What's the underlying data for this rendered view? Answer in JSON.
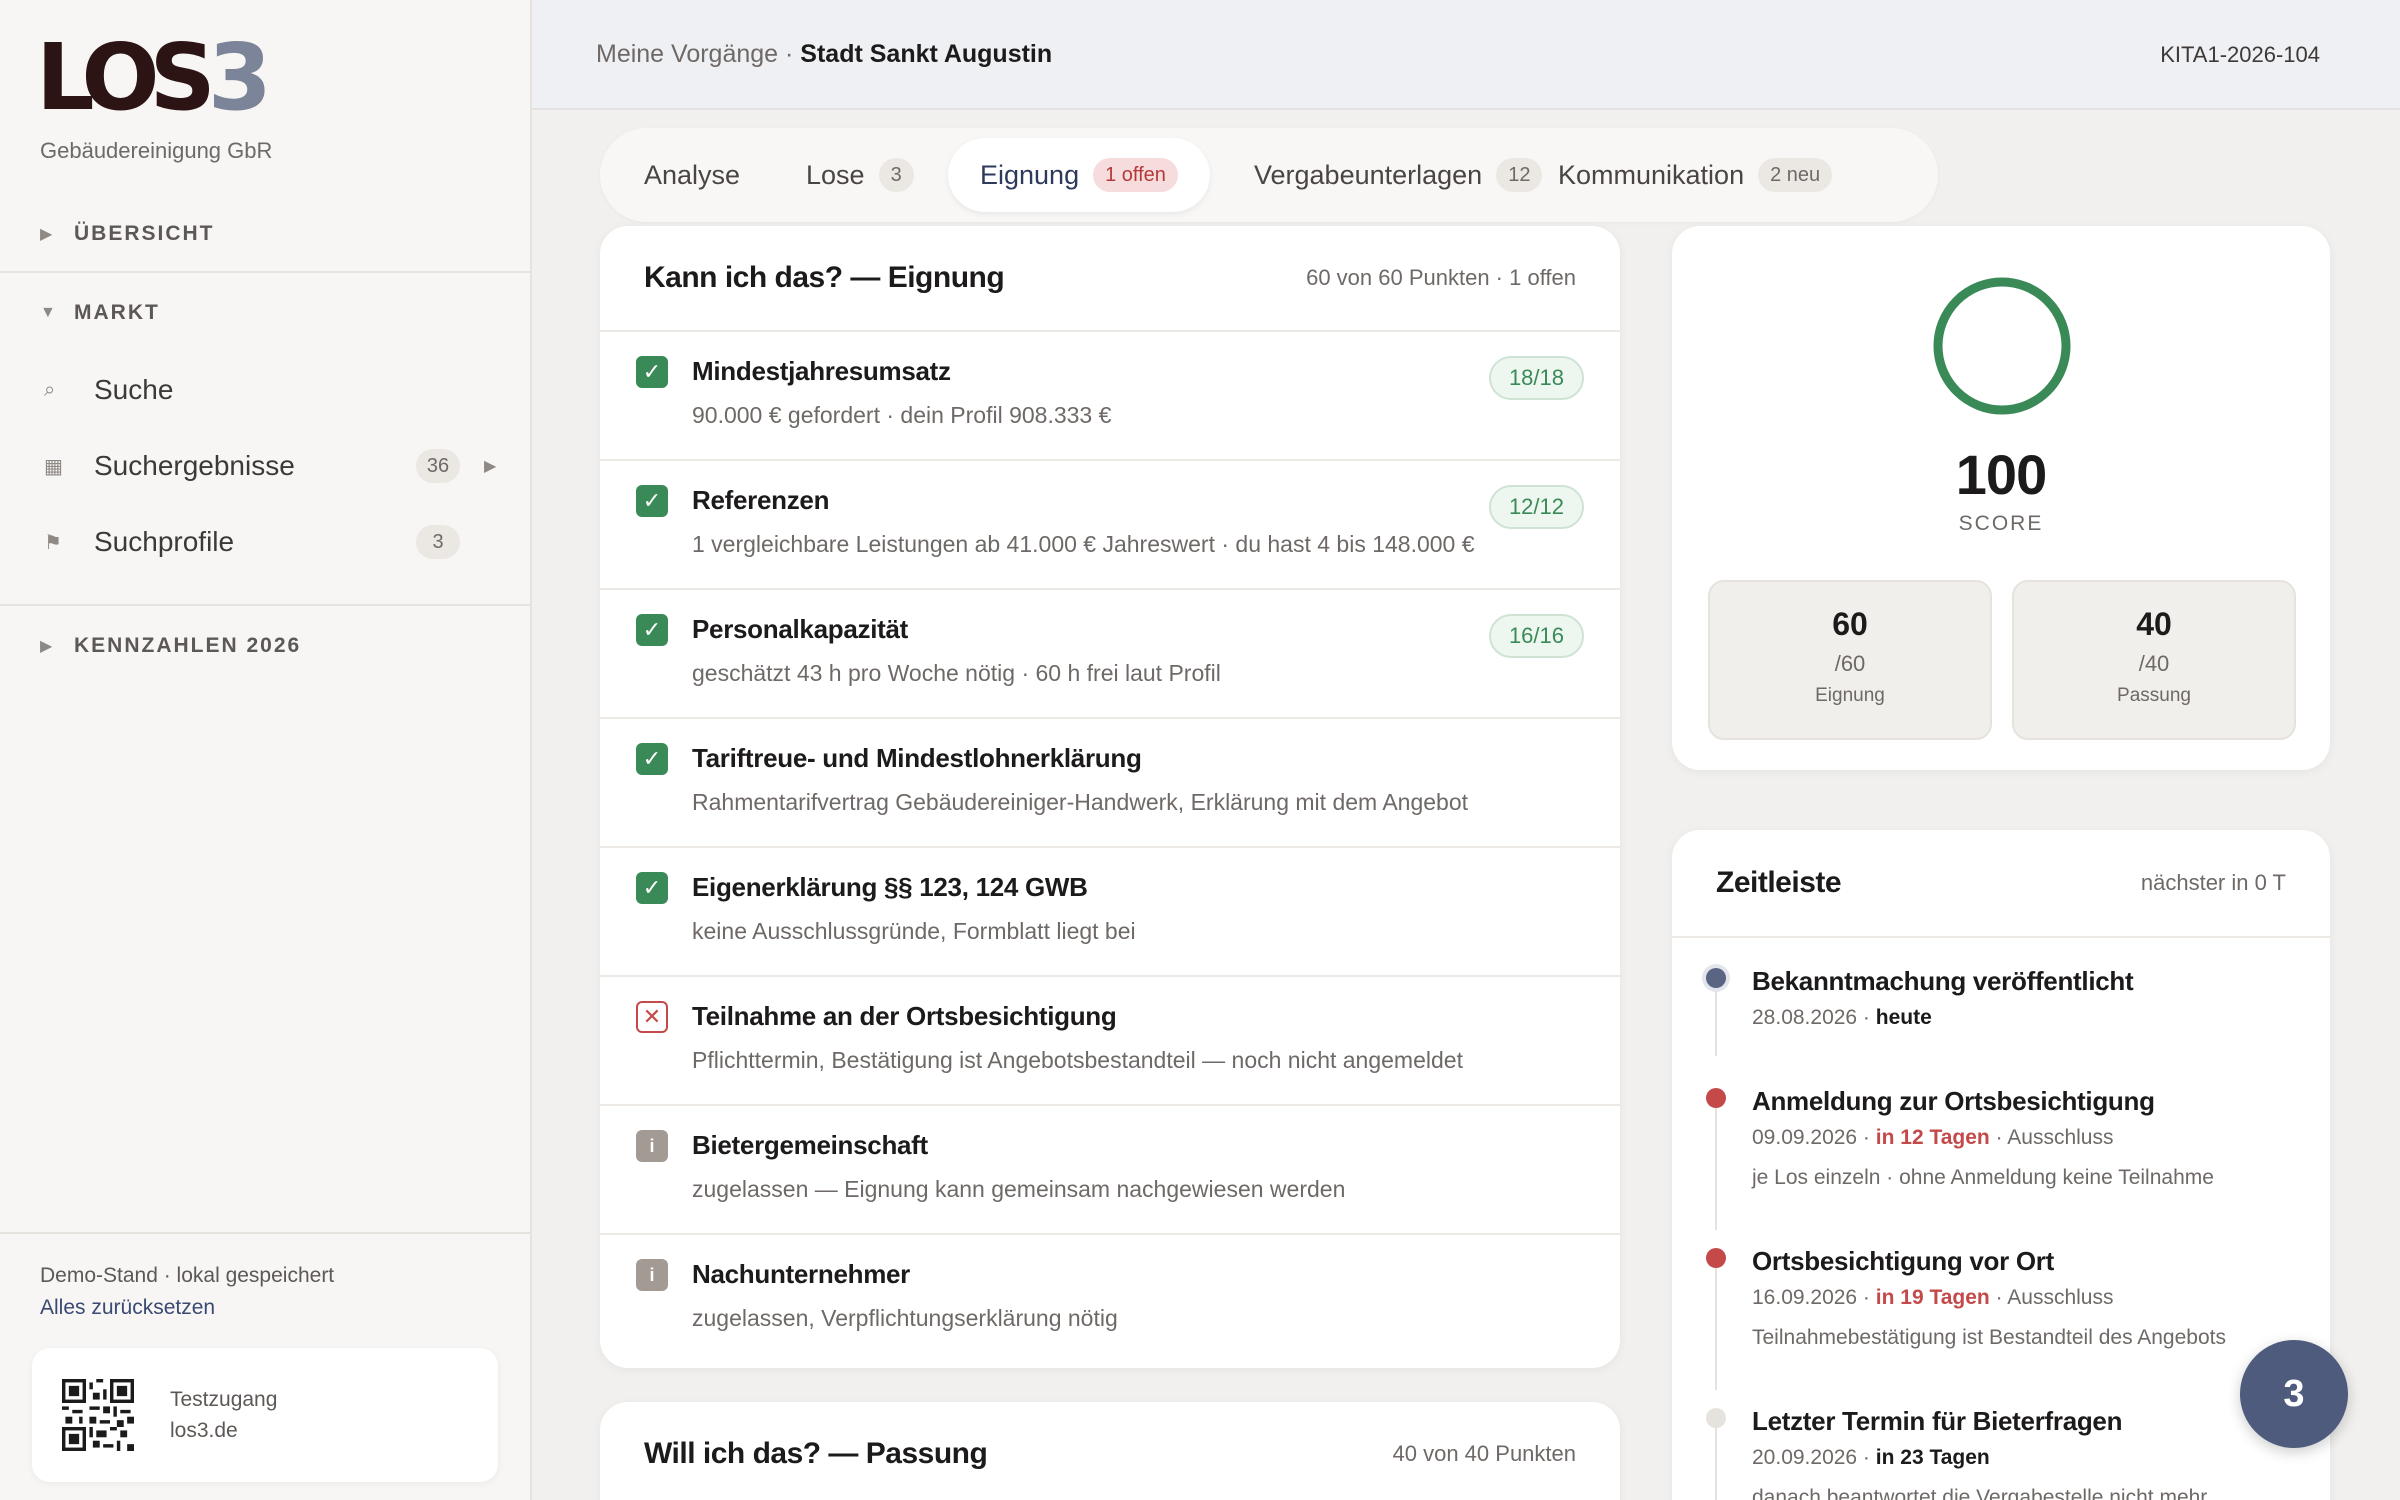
{
  "brand": {
    "logo_main": "LOS",
    "logo_num": "3",
    "company": "Gebäudereinigung GbR"
  },
  "sidebar": {
    "sections": [
      {
        "label": "ÜBERSICHT",
        "expanded": false
      },
      {
        "label": "MARKT",
        "expanded": true
      },
      {
        "label": "KENNZAHLEN 2026",
        "expanded": false
      }
    ],
    "items": [
      {
        "label": "Suche",
        "icon": "search-icon"
      },
      {
        "label": "Suchergebnisse",
        "icon": "grid-icon",
        "count": "36"
      },
      {
        "label": "Suchprofile",
        "icon": "flag-icon",
        "count": "3"
      }
    ],
    "footer": {
      "status": "Demo-Stand · lokal gespeichert",
      "reset": "Alles zurücksetzen",
      "qr_line1": "Testzugang",
      "qr_line2": "los3.de"
    }
  },
  "header": {
    "crumb_prefix": "Meine Vorgänge · ",
    "crumb_current": "Stadt Sankt Augustin",
    "ref": "KITA1-2026-104"
  },
  "tabs": [
    {
      "label": "Analyse"
    },
    {
      "label": "Lose",
      "badge": "3"
    },
    {
      "label": "Eignung",
      "badge": "1 offen",
      "active": true
    },
    {
      "label": "Vergabeunterlagen",
      "badge": "12"
    },
    {
      "label": "Kommunikation",
      "badge": "2 neu"
    }
  ],
  "eignung": {
    "title": "Kann ich das? — Eignung",
    "meta": "60 von 60 Punkten · 1 offen",
    "rows": [
      {
        "status": "ok",
        "title": "Mindestjahresumsatz",
        "sub": "90.000 € gefordert · dein Profil 908.333 €",
        "score": "18/18"
      },
      {
        "status": "ok",
        "title": "Referenzen",
        "sub": "1 vergleichbare Leistungen ab 41.000 € Jahreswert · du hast 4 bis 148.000 €",
        "score": "12/12"
      },
      {
        "status": "ok",
        "title": "Personalkapazität",
        "sub": "geschätzt 43 h pro Woche nötig · 60 h frei laut Profil",
        "score": "16/16"
      },
      {
        "status": "ok",
        "title": "Tariftreue- und Mindestlohnerklärung",
        "sub": "Rahmentarifvertrag Gebäudereiniger-Handwerk, Erklärung mit dem Angebot"
      },
      {
        "status": "ok",
        "title": "Eigenerklärung §§ 123, 124 GWB",
        "sub": "keine Ausschlussgründe, Formblatt liegt bei"
      },
      {
        "status": "bad",
        "title": "Teilnahme an der Ortsbesichtigung",
        "sub": "Pflichttermin, Bestätigung ist Angebotsbestandteil — noch nicht angemeldet"
      },
      {
        "status": "info",
        "title": "Bietergemeinschaft",
        "sub": "zugelassen — Eignung kann gemeinsam nachgewiesen werden"
      },
      {
        "status": "info",
        "title": "Nachunternehmer",
        "sub": "zugelassen, Verpflichtungserklärung nötig"
      }
    ]
  },
  "passung": {
    "title": "Will ich das? — Passung",
    "meta": "40 von 40 Punkten"
  },
  "score": {
    "value": "100",
    "label": "SCORE",
    "ratio": 1.0,
    "ring_color": "#3a8a58",
    "parts": [
      {
        "value": "60",
        "max": "/60",
        "name": "Eignung"
      },
      {
        "value": "40",
        "max": "/40",
        "name": "Passung"
      }
    ]
  },
  "timeline": {
    "title": "Zeitleiste",
    "meta": "nächster in 0 T",
    "items": [
      {
        "title": "Bekanntmachung veröffentlicht",
        "date": "28.08.2026 · ",
        "rel": "heute",
        "rel_style": "dark",
        "tail": "",
        "note": "",
        "dot": "#5a6584"
      },
      {
        "title": "Anmeldung zur Ortsbesichtigung",
        "date": "09.09.2026 · ",
        "rel": "in 12 Tagen",
        "rel_style": "hot",
        "tail": " · Ausschluss",
        "note": "je Los einzeln · ohne Anmeldung keine Teilnahme",
        "dot": "#c44a4a"
      },
      {
        "title": "Ortsbesichtigung vor Ort",
        "date": "16.09.2026 · ",
        "rel": "in 19 Tagen",
        "rel_style": "hot",
        "tail": " · Ausschluss",
        "note": "Teilnahmebestätigung ist Bestandteil des Angebots",
        "dot": "#c44a4a"
      },
      {
        "title": "Letzter Termin für Bieterfragen",
        "date": "20.09.2026 · ",
        "rel": "in 23 Tagen",
        "rel_style": "dark",
        "tail": "",
        "note": "danach beantwortet die Vergabestelle nicht mehr",
        "dot": "#e6e3df"
      }
    ]
  },
  "fab": {
    "label": "3"
  }
}
